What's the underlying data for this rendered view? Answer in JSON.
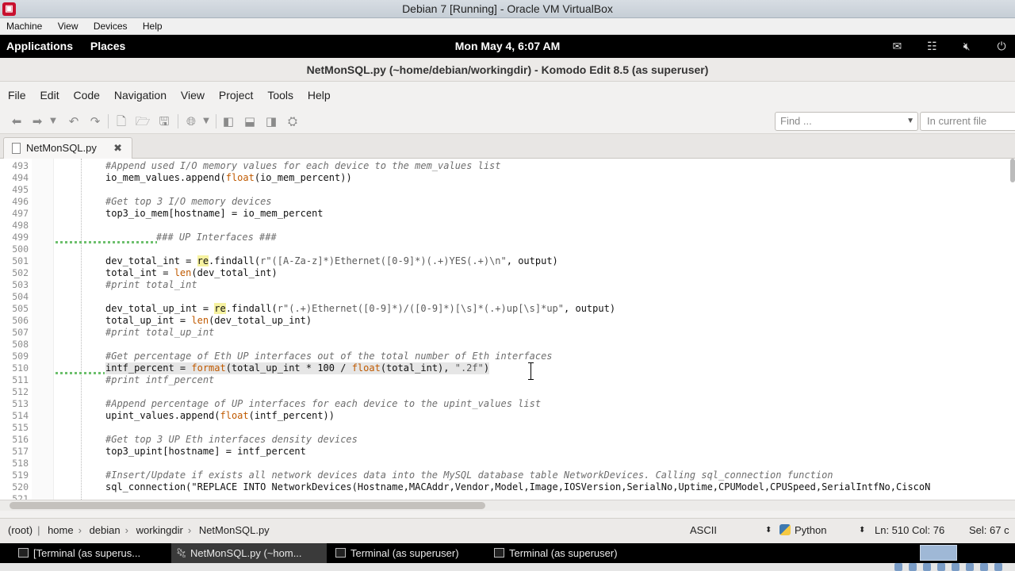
{
  "vbox": {
    "title": "Debian 7 [Running] - Oracle VM VirtualBox",
    "menu": [
      "Machine",
      "View",
      "Devices",
      "Help"
    ]
  },
  "panel": {
    "applications": "Applications",
    "places": "Places",
    "clock": "Mon May  4,  6:07 AM",
    "tray_icons": [
      "notification-icon",
      "network-icon",
      "volume-muted-icon",
      "power-icon"
    ]
  },
  "komodo": {
    "title": "NetMonSQL.py (~home/debian/workingdir) - Komodo Edit 8.5 (as superuser)",
    "menu": [
      "File",
      "Edit",
      "Code",
      "Navigation",
      "View",
      "Project",
      "Tools",
      "Help"
    ],
    "find_placeholder": "Find ...",
    "find_scope": "In current file",
    "tab": "NetMonSQL.py",
    "status": {
      "breadcrumb": [
        "(root)",
        "home",
        "debian",
        "workingdir",
        "NetMonSQL.py"
      ],
      "encoding": "ASCII",
      "language": "Python",
      "position": "Ln: 510 Col: 76",
      "selection": "Sel: 67 c"
    }
  },
  "code": [
    {
      "n": "493",
      "t": "#Append used I/O memory values for each device to the mem_values list"
    },
    {
      "n": "494",
      "t": "io_mem_values.append(float(io_mem_percent))"
    },
    {
      "n": "495",
      "t": ""
    },
    {
      "n": "496",
      "t": "#Get top 3 I/O memory devices"
    },
    {
      "n": "497",
      "t": "top3_io_mem[hostname] = io_mem_percent"
    },
    {
      "n": "498",
      "t": ""
    },
    {
      "n": "499",
      "t": "### UP Interfaces ###"
    },
    {
      "n": "500",
      "t": ""
    },
    {
      "n": "501",
      "t": "dev_total_int = re.findall(r\"([A-Za-z]*)Ethernet([0-9]*)(.+)YES(.+)\\n\", output)"
    },
    {
      "n": "502",
      "t": "total_int = len(dev_total_int)"
    },
    {
      "n": "503",
      "t": "#print total_int"
    },
    {
      "n": "504",
      "t": ""
    },
    {
      "n": "505",
      "t": "dev_total_up_int = re.findall(r\"(.+)Ethernet([0-9]*)/([0-9]*)[\\s]*(.+)up[\\s]*up\", output)"
    },
    {
      "n": "506",
      "t": "total_up_int = len(dev_total_up_int)"
    },
    {
      "n": "507",
      "t": "#print total_up_int"
    },
    {
      "n": "508",
      "t": ""
    },
    {
      "n": "509",
      "t": "#Get percentage of Eth UP interfaces out of the total number of Eth interfaces"
    },
    {
      "n": "510",
      "t": "intf_percent = format(total_up_int * 100 / float(total_int), \".2f\")"
    },
    {
      "n": "511",
      "t": "#print intf_percent"
    },
    {
      "n": "512",
      "t": ""
    },
    {
      "n": "513",
      "t": "#Append percentage of UP interfaces for each device to the upint_values list"
    },
    {
      "n": "514",
      "t": "upint_values.append(float(intf_percent))"
    },
    {
      "n": "515",
      "t": ""
    },
    {
      "n": "516",
      "t": "#Get top 3 UP Eth interfaces density devices"
    },
    {
      "n": "517",
      "t": "top3_upint[hostname] = intf_percent"
    },
    {
      "n": "518",
      "t": ""
    },
    {
      "n": "519",
      "t": "#Insert/Update if exists all network devices data into the MySQL database table NetworkDevices. Calling sql_connection function"
    },
    {
      "n": "520",
      "t": "sql_connection(\"REPLACE INTO NetworkDevices(Hostname,MACAddr,Vendor,Model,Image,IOSVersion,SerialNo,Uptime,CPUModel,CPUSpeed,SerialIntfNo,CiscoN"
    },
    {
      "n": "521",
      "t": ""
    }
  ],
  "taskbar": [
    {
      "label": "[Terminal (as superus...",
      "active": false
    },
    {
      "label": "NetMonSQL.py (~hom...",
      "active": true
    },
    {
      "label": "Terminal (as superuser)",
      "active": false
    },
    {
      "label": "Terminal (as superuser)",
      "active": false
    }
  ]
}
